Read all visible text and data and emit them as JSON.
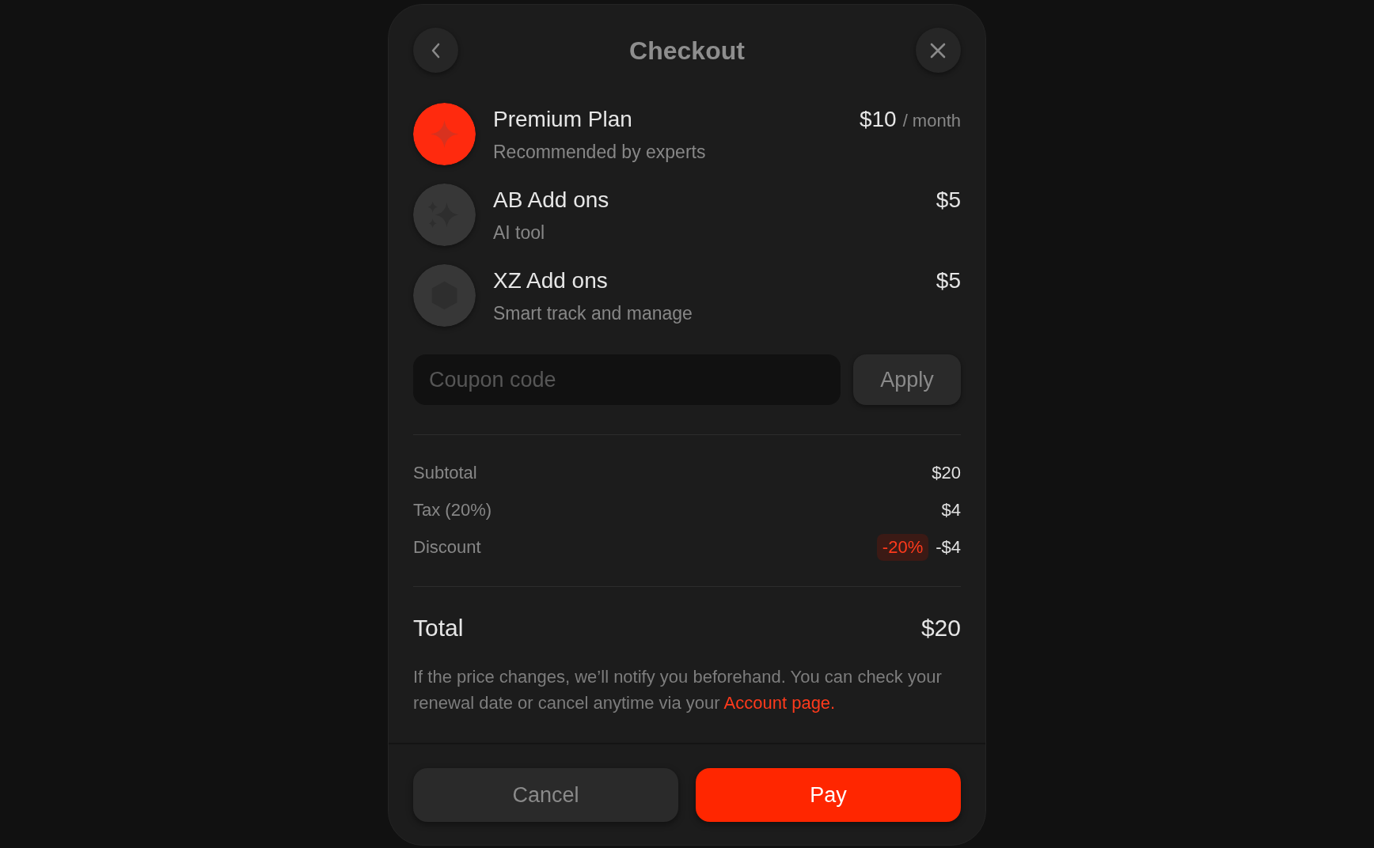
{
  "header": {
    "title": "Checkout"
  },
  "items": [
    {
      "name": "Premium Plan",
      "description": "Recommended by experts",
      "price": "$10",
      "period": "/ month",
      "selected": true
    },
    {
      "name": "AB Add ons",
      "description": "AI tool",
      "price": "$5",
      "selected": false
    },
    {
      "name": "XZ Add ons",
      "description": "Smart track and manage",
      "price": "$5",
      "selected": false
    }
  ],
  "coupon": {
    "placeholder": "Coupon code",
    "button": "Apply"
  },
  "summary": [
    {
      "label": "Subtotal",
      "value": "$20"
    },
    {
      "label": "Tax (20%)",
      "value": "$4"
    },
    {
      "label": "Discount",
      "badge": "-20%",
      "value": "-$4"
    }
  ],
  "total": {
    "label": "Total",
    "value": "$20"
  },
  "note": {
    "text": "If the price changes, we’ll notify you beforehand. You can check your renewal date or cancel anytime via your",
    "link": "Account page."
  },
  "buttons": {
    "cancel": "Cancel",
    "pay": "Pay"
  }
}
